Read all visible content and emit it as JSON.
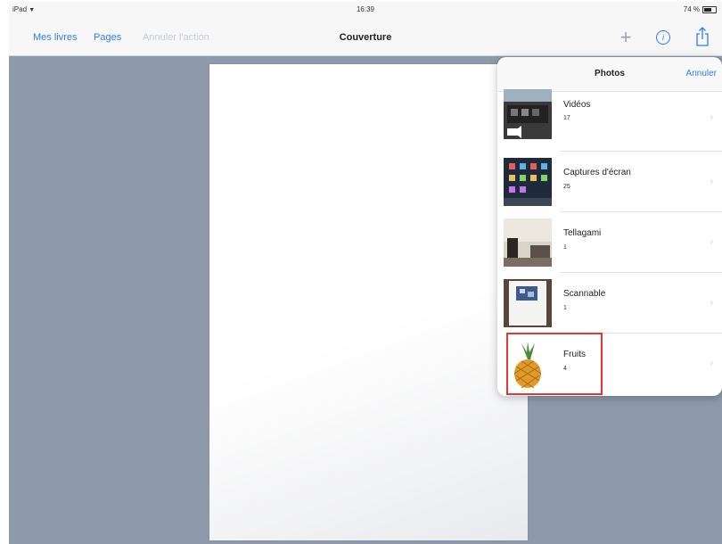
{
  "status_bar": {
    "device": "iPad",
    "time": "16:39",
    "battery": "74 %"
  },
  "nav": {
    "mes_livres": "Mes livres",
    "pages": "Pages",
    "annuler_action": "Annuler l'action",
    "title": "Couverture"
  },
  "popover": {
    "title": "Photos",
    "cancel": "Annuler",
    "albums": [
      {
        "name": "Vidéos",
        "count": "17"
      },
      {
        "name": "Captures d'écran",
        "count": "25"
      },
      {
        "name": "Tellagami",
        "count": "1"
      },
      {
        "name": "Scannable",
        "count": "1"
      },
      {
        "name": "Fruits",
        "count": "4"
      }
    ]
  },
  "colors": {
    "accent": "#2f7cf6",
    "background": "#8e9aaa",
    "highlight": "#e53535"
  }
}
